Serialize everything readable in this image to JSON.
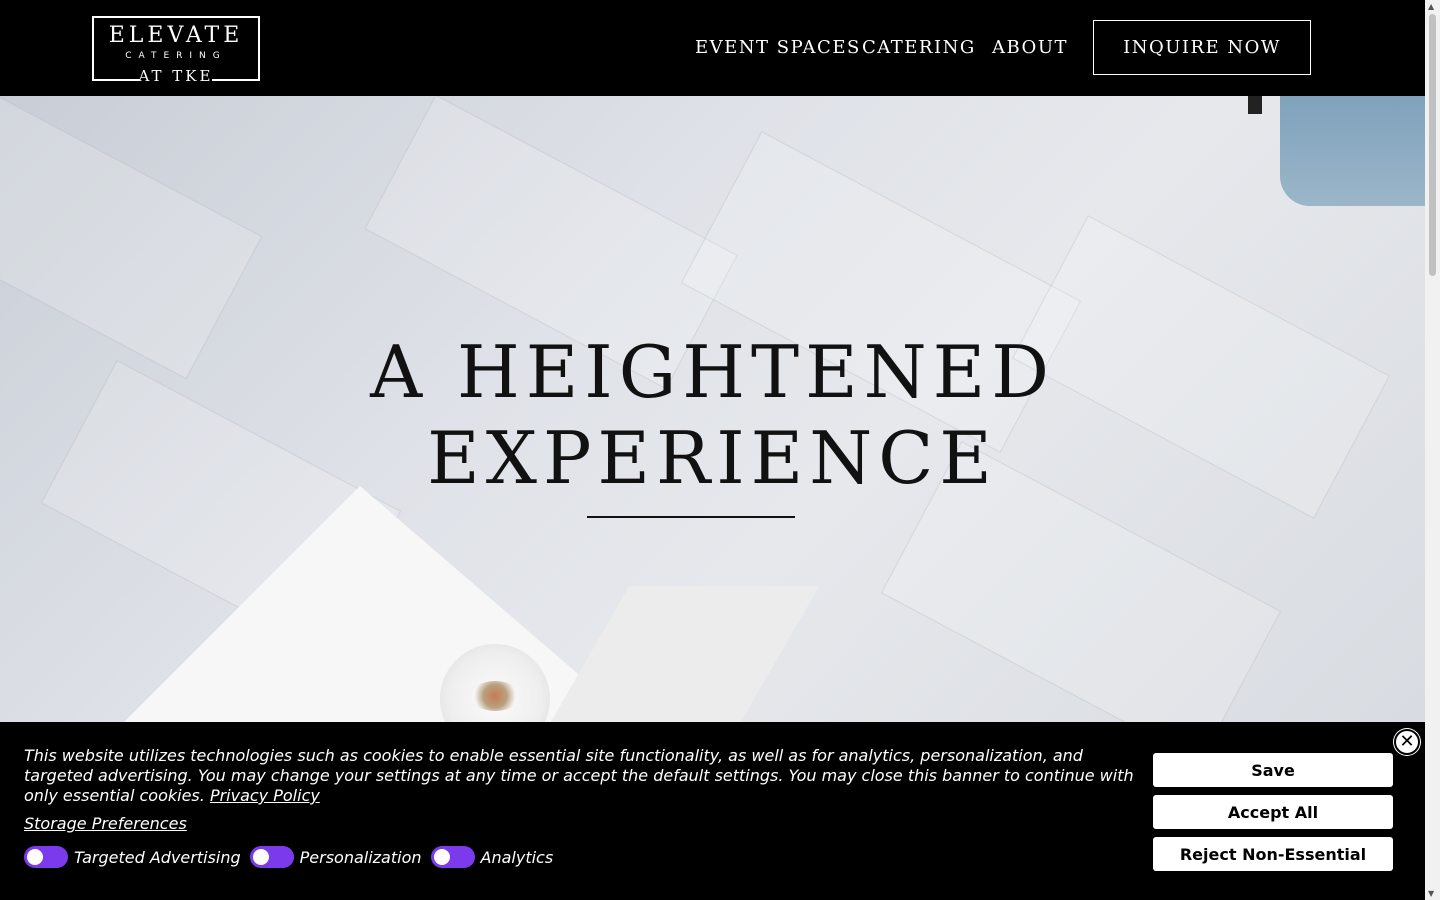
{
  "header": {
    "logo": {
      "line1": "ELEVATE",
      "line2": "CATERING",
      "line3": "AT TKE"
    },
    "nav": [
      "EVENT SPACES",
      "CATERING",
      "ABOUT"
    ],
    "cta": "INQUIRE NOW"
  },
  "hero": {
    "title_line1": "A HEIGHTENED",
    "title_line2": "EXPERIENCE"
  },
  "cookie_banner": {
    "text": "This website utilizes technologies such as cookies to enable essential site functionality, as well as for analytics, personalization, and targeted advertising. You may change your settings at any time or accept the default settings. You may close this banner to continue with only essential cookies.",
    "privacy_link": "Privacy Policy",
    "storage_link": "Storage Preferences",
    "toggles": [
      {
        "label": "Targeted Advertising",
        "on": true
      },
      {
        "label": "Personalization",
        "on": true
      },
      {
        "label": "Analytics",
        "on": true
      }
    ],
    "buttons": {
      "save": "Save",
      "accept": "Accept All",
      "reject": "Reject Non-Essential"
    },
    "colors": {
      "toggle": "#7c3aed"
    }
  },
  "icons": {
    "close": "close-icon"
  }
}
